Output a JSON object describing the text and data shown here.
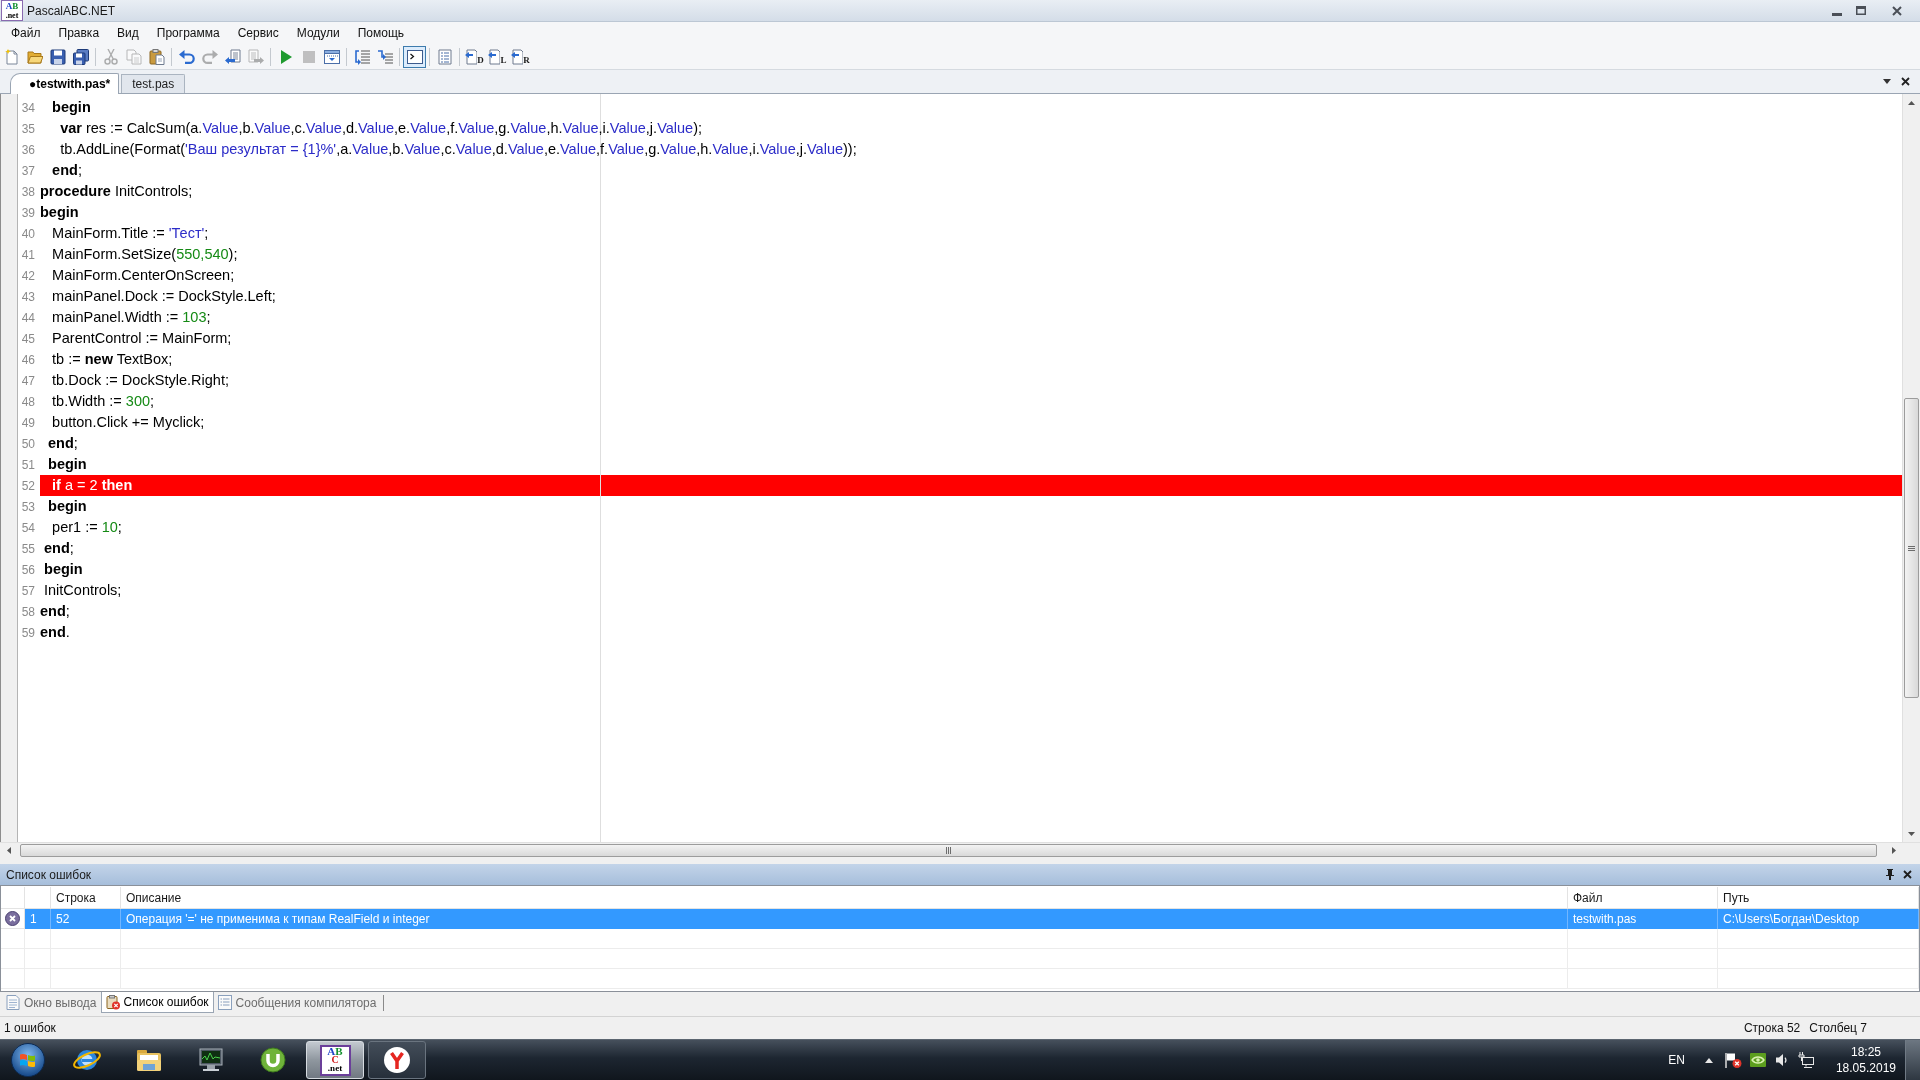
{
  "window": {
    "title": "PascalABC.NET",
    "icon_text": [
      "AB",
      ".net"
    ]
  },
  "menu": [
    "Файл",
    "Правка",
    "Вид",
    "Программа",
    "Сервис",
    "Модули",
    "Помощь"
  ],
  "toolbar": [
    {
      "buttons": [
        {
          "disabled": false,
          "pressed": false
        },
        {
          "disabled": false,
          "pressed": false
        },
        {
          "disabled": false,
          "pressed": false
        },
        {
          "disabled": false,
          "pressed": false
        }
      ]
    },
    {
      "buttons": [
        {
          "disabled": true,
          "pressed": false
        },
        {
          "disabled": true,
          "pressed": false
        },
        {
          "disabled": false,
          "pressed": false
        }
      ]
    },
    {
      "buttons": [
        {
          "disabled": false,
          "pressed": false
        },
        {
          "disabled": true,
          "pressed": false
        },
        {
          "disabled": false,
          "pressed": false
        },
        {
          "disabled": true,
          "pressed": false
        }
      ]
    },
    {
      "buttons": [
        {
          "disabled": false,
          "pressed": false
        },
        {
          "disabled": true,
          "pressed": false
        },
        {
          "disabled": false,
          "pressed": false
        }
      ]
    },
    {
      "buttons": [
        {
          "disabled": false,
          "pressed": false
        },
        {
          "disabled": false,
          "pressed": false
        }
      ]
    },
    {
      "buttons": [
        {
          "disabled": false,
          "pressed": true
        }
      ]
    },
    {
      "buttons": [
        {
          "disabled": false,
          "pressed": false
        }
      ]
    },
    {
      "buttons": [
        {
          "disabled": false,
          "pressed": false,
          "label": "D"
        },
        {
          "disabled": false,
          "pressed": false,
          "label": "L"
        },
        {
          "disabled": false,
          "pressed": false,
          "label": "R"
        }
      ]
    }
  ],
  "tabs": [
    {
      "label": "●testwith.pas*",
      "selected": true
    },
    {
      "label": "test.pas",
      "selected": false
    }
  ],
  "editor": {
    "lines": [
      {
        "number": "34",
        "highlighted": false,
        "tokens": [
          {
            "kind": "keyword",
            "text": "   begin"
          }
        ]
      },
      {
        "number": "35",
        "highlighted": false,
        "tokens": [
          {
            "kind": "keyword",
            "text": "     var"
          },
          {
            "kind": "plain",
            "text": " res := CalcSum(a."
          },
          {
            "kind": "member",
            "text": "Value"
          },
          {
            "kind": "plain",
            "text": ",b."
          },
          {
            "kind": "member",
            "text": "Value"
          },
          {
            "kind": "plain",
            "text": ",c."
          },
          {
            "kind": "member",
            "text": "Value"
          },
          {
            "kind": "plain",
            "text": ",d."
          },
          {
            "kind": "member",
            "text": "Value"
          },
          {
            "kind": "plain",
            "text": ",e."
          },
          {
            "kind": "member",
            "text": "Value"
          },
          {
            "kind": "plain",
            "text": ",f."
          },
          {
            "kind": "member",
            "text": "Value"
          },
          {
            "kind": "plain",
            "text": ",g."
          },
          {
            "kind": "member",
            "text": "Value"
          },
          {
            "kind": "plain",
            "text": ",h."
          },
          {
            "kind": "member",
            "text": "Value"
          },
          {
            "kind": "plain",
            "text": ",i."
          },
          {
            "kind": "member",
            "text": "Value"
          },
          {
            "kind": "plain",
            "text": ",j."
          },
          {
            "kind": "member",
            "text": "Value"
          },
          {
            "kind": "plain",
            "text": ");"
          }
        ]
      },
      {
        "number": "36",
        "highlighted": false,
        "tokens": [
          {
            "kind": "plain",
            "text": "     tb.AddLine(Format("
          },
          {
            "kind": "string",
            "text": "'Ваш результат = {1}%'"
          },
          {
            "kind": "plain",
            "text": ",a."
          },
          {
            "kind": "member",
            "text": "Value"
          },
          {
            "kind": "plain",
            "text": ",b."
          },
          {
            "kind": "member",
            "text": "Value"
          },
          {
            "kind": "plain",
            "text": ",c."
          },
          {
            "kind": "member",
            "text": "Value"
          },
          {
            "kind": "plain",
            "text": ",d."
          },
          {
            "kind": "member",
            "text": "Value"
          },
          {
            "kind": "plain",
            "text": ",e."
          },
          {
            "kind": "member",
            "text": "Value"
          },
          {
            "kind": "plain",
            "text": ",f."
          },
          {
            "kind": "member",
            "text": "Value"
          },
          {
            "kind": "plain",
            "text": ",g."
          },
          {
            "kind": "member",
            "text": "Value"
          },
          {
            "kind": "plain",
            "text": ",h."
          },
          {
            "kind": "member",
            "text": "Value"
          },
          {
            "kind": "plain",
            "text": ",i."
          },
          {
            "kind": "member",
            "text": "Value"
          },
          {
            "kind": "plain",
            "text": ",j."
          },
          {
            "kind": "member",
            "text": "Value"
          },
          {
            "kind": "plain",
            "text": "));"
          }
        ]
      },
      {
        "number": "37",
        "highlighted": false,
        "tokens": [
          {
            "kind": "keyword",
            "text": "   end"
          },
          {
            "kind": "plain",
            "text": ";"
          }
        ]
      },
      {
        "number": "38",
        "highlighted": false,
        "tokens": [
          {
            "kind": "keyword",
            "text": "procedure"
          },
          {
            "kind": "plain",
            "text": " InitControls;"
          }
        ]
      },
      {
        "number": "39",
        "highlighted": false,
        "tokens": [
          {
            "kind": "keyword",
            "text": "begin"
          }
        ]
      },
      {
        "number": "40",
        "highlighted": false,
        "tokens": [
          {
            "kind": "plain",
            "text": "   MainForm.Title := "
          },
          {
            "kind": "string",
            "text": "'Тест'"
          },
          {
            "kind": "plain",
            "text": ";"
          }
        ]
      },
      {
        "number": "41",
        "highlighted": false,
        "tokens": [
          {
            "kind": "plain",
            "text": "   MainForm.SetSize("
          },
          {
            "kind": "number",
            "text": "550,540"
          },
          {
            "kind": "plain",
            "text": ");"
          }
        ]
      },
      {
        "number": "42",
        "highlighted": false,
        "tokens": [
          {
            "kind": "plain",
            "text": "   MainForm.CenterOnScreen;"
          }
        ]
      },
      {
        "number": "43",
        "highlighted": false,
        "tokens": [
          {
            "kind": "plain",
            "text": "   mainPanel.Dock := DockStyle.Left;"
          }
        ]
      },
      {
        "number": "44",
        "highlighted": false,
        "tokens": [
          {
            "kind": "plain",
            "text": "   mainPanel.Width := "
          },
          {
            "kind": "number",
            "text": "103"
          },
          {
            "kind": "plain",
            "text": ";"
          }
        ]
      },
      {
        "number": "45",
        "highlighted": false,
        "tokens": [
          {
            "kind": "plain",
            "text": "   ParentControl := MainForm;"
          }
        ]
      },
      {
        "number": "46",
        "highlighted": false,
        "tokens": [
          {
            "kind": "plain",
            "text": "   tb := "
          },
          {
            "kind": "keyword",
            "text": "new"
          },
          {
            "kind": "plain",
            "text": " TextBox;"
          }
        ]
      },
      {
        "number": "47",
        "highlighted": false,
        "tokens": [
          {
            "kind": "plain",
            "text": "   tb.Dock := DockStyle.Right;"
          }
        ]
      },
      {
        "number": "48",
        "highlighted": false,
        "tokens": [
          {
            "kind": "plain",
            "text": "   tb.Width := "
          },
          {
            "kind": "number",
            "text": "300"
          },
          {
            "kind": "plain",
            "text": ";"
          }
        ]
      },
      {
        "number": "49",
        "highlighted": false,
        "tokens": [
          {
            "kind": "plain",
            "text": "   button.Click += Myclick;"
          }
        ]
      },
      {
        "number": "50",
        "highlighted": false,
        "tokens": [
          {
            "kind": "keyword",
            "text": "  end"
          },
          {
            "kind": "plain",
            "text": ";"
          }
        ]
      },
      {
        "number": "51",
        "highlighted": false,
        "tokens": [
          {
            "kind": "keyword",
            "text": "  begin"
          }
        ]
      },
      {
        "number": "52",
        "highlighted": true,
        "tokens": [
          {
            "kind": "keyword",
            "text": "   if"
          },
          {
            "kind": "plain",
            "text": " a = "
          },
          {
            "kind": "number",
            "text": "2"
          },
          {
            "kind": "keyword",
            "text": " then"
          }
        ]
      },
      {
        "number": "53",
        "highlighted": false,
        "tokens": [
          {
            "kind": "keyword",
            "text": "  begin"
          }
        ]
      },
      {
        "number": "54",
        "highlighted": false,
        "tokens": [
          {
            "kind": "plain",
            "text": "   per1 := "
          },
          {
            "kind": "number",
            "text": "10"
          },
          {
            "kind": "plain",
            "text": ";"
          }
        ]
      },
      {
        "number": "55",
        "highlighted": false,
        "tokens": [
          {
            "kind": "keyword",
            "text": " end"
          },
          {
            "kind": "plain",
            "text": ";"
          }
        ]
      },
      {
        "number": "56",
        "highlighted": false,
        "tokens": [
          {
            "kind": "keyword",
            "text": " begin"
          }
        ]
      },
      {
        "number": "57",
        "highlighted": false,
        "tokens": [
          {
            "kind": "plain",
            "text": " InitControls;"
          }
        ]
      },
      {
        "number": "58",
        "highlighted": false,
        "tokens": [
          {
            "kind": "keyword",
            "text": "end"
          },
          {
            "kind": "plain",
            "text": ";"
          }
        ]
      },
      {
        "number": "59",
        "highlighted": false,
        "tokens": [
          {
            "kind": "keyword",
            "text": "end"
          },
          {
            "kind": "plain",
            "text": "."
          }
        ]
      }
    ]
  },
  "error_list": {
    "title": "Список ошибок",
    "columns": [
      "",
      "Строка",
      "Описание",
      "Файл",
      "Путь"
    ],
    "rows": [
      {
        "kind": "error",
        "selected": true,
        "cells": [
          "1",
          "52",
          "Операция '=' не применима к типам RealField и integer",
          "testwith.pas",
          "C:\\Users\\Богдан\\Desktop"
        ]
      }
    ]
  },
  "panel_tabs": [
    {
      "label": "Окно вывода",
      "selected": false
    },
    {
      "label": "Список ошибок",
      "selected": true
    },
    {
      "label": "Сообщения компилятора",
      "selected": false
    }
  ],
  "status_bar": {
    "message": "1 ошибок",
    "position": [
      "Строка 52",
      "Столбец 7"
    ]
  },
  "taskbar": {
    "apps": [
      {
        "open": false,
        "selected": false
      },
      {
        "open": false,
        "selected": false
      },
      {
        "open": false,
        "selected": false
      },
      {
        "open": false,
        "selected": false
      },
      {
        "open": true,
        "selected": true,
        "logo_text": [
          "AB",
          "C",
          ".net"
        ]
      },
      {
        "open": true,
        "selected": false
      }
    ],
    "tray": {
      "language": "EN",
      "time": "18:25",
      "date": "18.05.2019"
    }
  }
}
